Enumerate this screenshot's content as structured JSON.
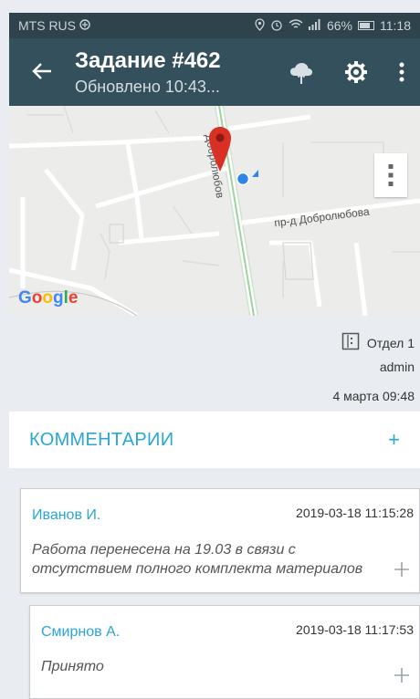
{
  "status": {
    "carrier": "MTS RUS",
    "battery": "66%",
    "time": "11:18"
  },
  "appbar": {
    "title": "Задание #462",
    "subtitle": "Обновлено 10:43..."
  },
  "map": {
    "street_top": "Добролюбов",
    "street_right": "пр-д Добролюбова",
    "brand": "Google"
  },
  "info": {
    "department": "Отдел 1",
    "user": "admin",
    "date": "4 марта 09:48"
  },
  "comments": {
    "header": "КОММЕНТАРИИ",
    "add_label": "+",
    "items": [
      {
        "author": "Иванов И.",
        "time": "2019-03-18 11:15:28",
        "text": "Работа перенесена на 19.03 в связи с отсутствием полного комплекта материалов"
      },
      {
        "author": "Смирнов А.",
        "time": "2019-03-18 11:17:53",
        "text": "Принято"
      }
    ]
  },
  "colors": {
    "appbar": "#34505c",
    "statusbar": "#2f434c",
    "accent": "#2aa6d8",
    "pin": "#d93025",
    "location": "#2f86e8"
  }
}
